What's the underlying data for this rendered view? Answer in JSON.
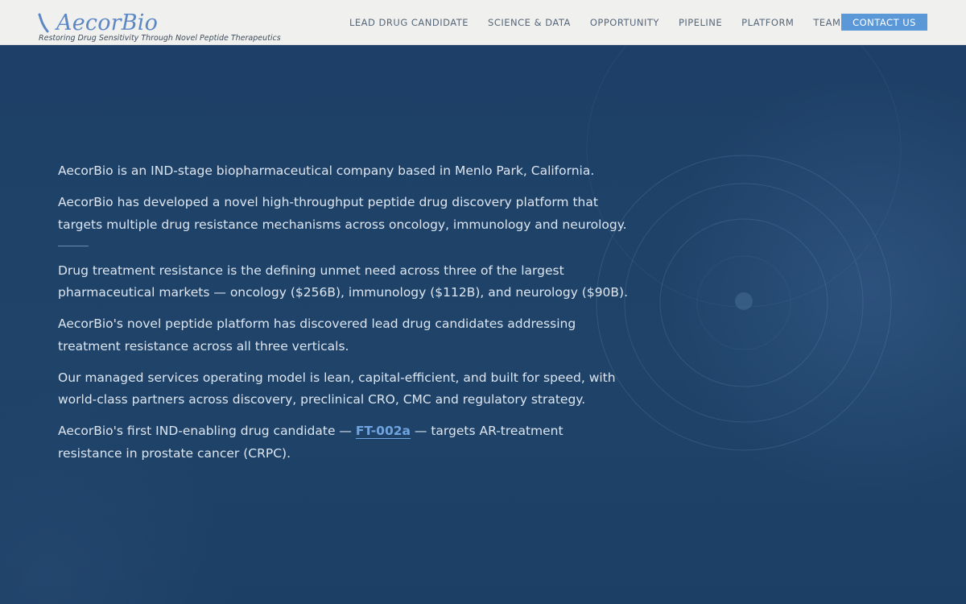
{
  "brand": {
    "name": "AecorBio",
    "tagline": "Restoring Drug Sensitivity Through Novel Peptide Therapeutics"
  },
  "nav": {
    "items": [
      {
        "label": "Lead Drug Candidate"
      },
      {
        "label": "Science & Data"
      },
      {
        "label": "Opportunity"
      },
      {
        "label": "Pipeline"
      },
      {
        "label": "Platform"
      },
      {
        "label": "Team"
      }
    ],
    "contact_label": "Contact Us"
  },
  "hero": {
    "p1": "AecorBio is an IND-stage biopharmaceutical company based in Menlo Park, California.",
    "p2": "AecorBio has developed a novel high-throughput peptide drug discovery platform that targets multiple drug resistance mechanisms across oncology, immunology and neurology.",
    "p3": "Drug treatment resistance is the defining unmet need across three of the largest pharmaceutical markets — oncology ($256B), immunology ($112B), and neurology ($90B).",
    "p4": "AecorBio's novel peptide platform has discovered lead drug candidates addressing treatment resistance across all three verticals.",
    "p5": "Our managed services operating model is lean, capital-efficient, and built for speed, with world-class partners across discovery, preclinical CRO, CMC and regulatory strategy.",
    "p6_prefix": "AecorBio's first IND-enabling drug candidate — ",
    "p6_link": "FT-002a",
    "p6_suffix": " — targets AR-treatment resistance in prostate cancer (CRPC)."
  },
  "colors": {
    "accent": "#5b98d8",
    "hero_bg": "#1d4068",
    "link": "#6fa4df",
    "topbar_bg": "#f0f0ef"
  },
  "icons": {
    "logo": "stylized-swoosh-icon",
    "background": "concentric-rings-decoration"
  }
}
